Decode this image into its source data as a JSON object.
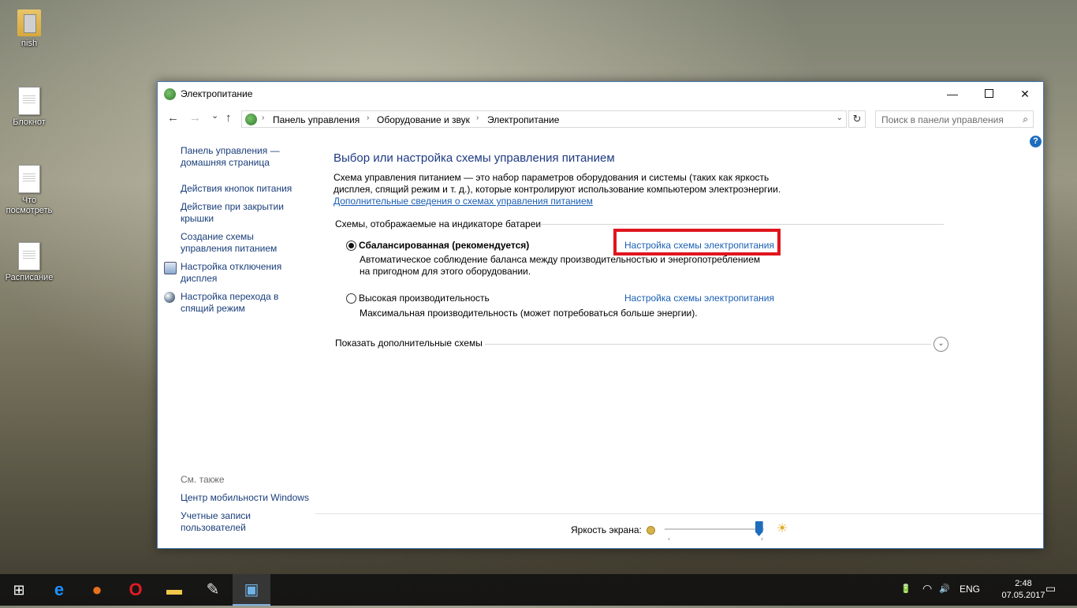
{
  "desktop": {
    "icons": [
      {
        "label": "nish"
      },
      {
        "label": "Блокнот"
      },
      {
        "label": "Что посмотреть"
      },
      {
        "label": "Расписание"
      }
    ]
  },
  "window": {
    "title": "Электропитание",
    "minimize_glyph": "—",
    "close_glyph": "✕"
  },
  "nav": {
    "back_glyph": "←",
    "forward_glyph": "→",
    "recent_glyph": "⌄",
    "up_glyph": "↑",
    "breadcrumbs": [
      "Панель управления",
      "Оборудование и звук",
      "Электропитание"
    ],
    "separator_glyph": "›",
    "dropdown_glyph": "⌄",
    "refresh_glyph": "↻",
    "search_placeholder": "Поиск в панели управления",
    "search_glyph": "⌕"
  },
  "help": {
    "glyph": "?"
  },
  "sidebar": {
    "home_link": "Панель управления — домашняя страница",
    "links": [
      {
        "label": "Действия кнопок питания",
        "icon": ""
      },
      {
        "label": "Действие при закрытии крышки",
        "icon": ""
      },
      {
        "label": "Создание схемы управления питанием",
        "icon": ""
      },
      {
        "label": "Настройка отключения дисплея",
        "icon": "display-icon"
      },
      {
        "label": "Настройка перехода в спящий режим",
        "icon": "moon-icon"
      }
    ],
    "see_also_title": "См. также",
    "see_also": [
      {
        "label": "Центр мобильности Windows"
      },
      {
        "label": "Учетные записи пользователей"
      }
    ]
  },
  "main": {
    "heading": "Выбор или настройка схемы управления питанием",
    "description": "Схема управления питанием — это набор параметров оборудования и системы (таких как яркость дисплея, спящий режим и т. д.), которые контролируют использование компьютером электроэнергии.",
    "more_link": "Дополнительные сведения о схемах управления питанием",
    "group_title": "Схемы, отображаемые на индикаторе батареи",
    "plans": [
      {
        "name": "Сбалансированная (рекомендуется)",
        "selected": true,
        "desc_line1": "Автоматическое соблюдение баланса между производительностью и энергопотреблением",
        "desc_line2": "на пригодном для этого оборудовании.",
        "link": "Настройка схемы электропитания"
      },
      {
        "name": "Высокая производительность",
        "selected": false,
        "desc_line1": "Максимальная производительность (может потребоваться больше энергии).",
        "link": "Настройка схемы электропитания"
      }
    ],
    "show_more": "Показать дополнительные схемы",
    "expand_glyph": "⌄"
  },
  "footer": {
    "brightness_label": "Яркость экрана:",
    "brightness_level": 0.95,
    "sun_glyph": "☀"
  },
  "taskbar": {
    "start_glyph": "⊞",
    "apps": [
      {
        "icon": "edge-icon",
        "glyph": "e",
        "color": "#1e90ff"
      },
      {
        "icon": "firefox-icon",
        "glyph": "●",
        "color": "#e8711c"
      },
      {
        "icon": "opera-icon",
        "glyph": "O",
        "color": "#e21b24"
      },
      {
        "icon": "file-explorer-icon",
        "glyph": "▬",
        "color": "#f2c74a"
      },
      {
        "icon": "paint-icon",
        "glyph": "✎",
        "color": "#e5e5e5"
      },
      {
        "icon": "control-panel-icon",
        "glyph": "▣",
        "color": "#6fb3e8"
      }
    ],
    "tray": {
      "battery_glyph": "🔋",
      "wifi_glyph": "◠",
      "volume_glyph": "🔊",
      "language": "ENG",
      "notifications_glyph": "▭"
    },
    "time": "2:48",
    "date": "07.05.2017"
  }
}
